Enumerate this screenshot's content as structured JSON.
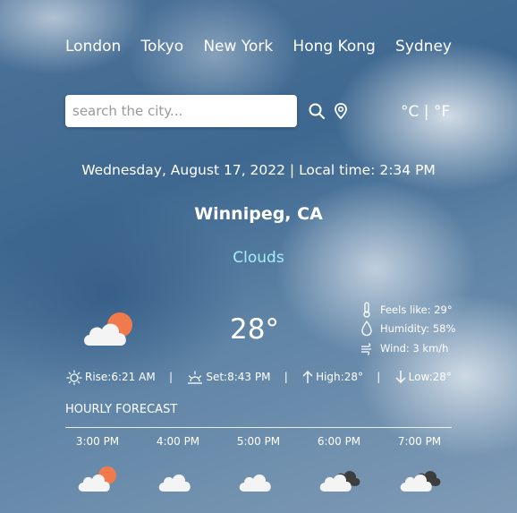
{
  "nav": {
    "cities": [
      "London",
      "Tokyo",
      "New York",
      "Hong Kong",
      "Sydney"
    ]
  },
  "search": {
    "placeholder": "search the city..."
  },
  "icons": {
    "search": "search-icon",
    "location": "location-pin-icon"
  },
  "units": {
    "celsius": "°C",
    "separator": "|",
    "fahrenheit": "°F"
  },
  "header": {
    "datetime": "Wednesday, August 17, 2022 | Local time: 2:34 PM",
    "city": "Winnipeg, CA",
    "condition": "Clouds"
  },
  "current": {
    "temperature": "28°",
    "icon": "cloud-sun-icon",
    "feels_like": "Feels like: 29°",
    "humidity": "Humidity: 58%",
    "wind": "Wind: 3 km/h"
  },
  "stats": {
    "rise": "Rise:6:21 AM",
    "set": "Set:8:43 PM",
    "high": "High:28°",
    "low": "Low:28°",
    "separator": "|"
  },
  "hourly": {
    "title": "HOURLY FORECAST",
    "items": [
      {
        "time": "3:00 PM",
        "icon": "cloud-sun-icon"
      },
      {
        "time": "4:00 PM",
        "icon": "cloud-icon"
      },
      {
        "time": "5:00 PM",
        "icon": "cloud-icon"
      },
      {
        "time": "6:00 PM",
        "icon": "broken-clouds-icon"
      },
      {
        "time": "7:00 PM",
        "icon": "broken-clouds-icon"
      }
    ]
  },
  "colors": {
    "condition": "#a8eef8",
    "sun": "#f07a4b",
    "dark_cloud": "#3d3d3d",
    "text": "#ffffff"
  }
}
